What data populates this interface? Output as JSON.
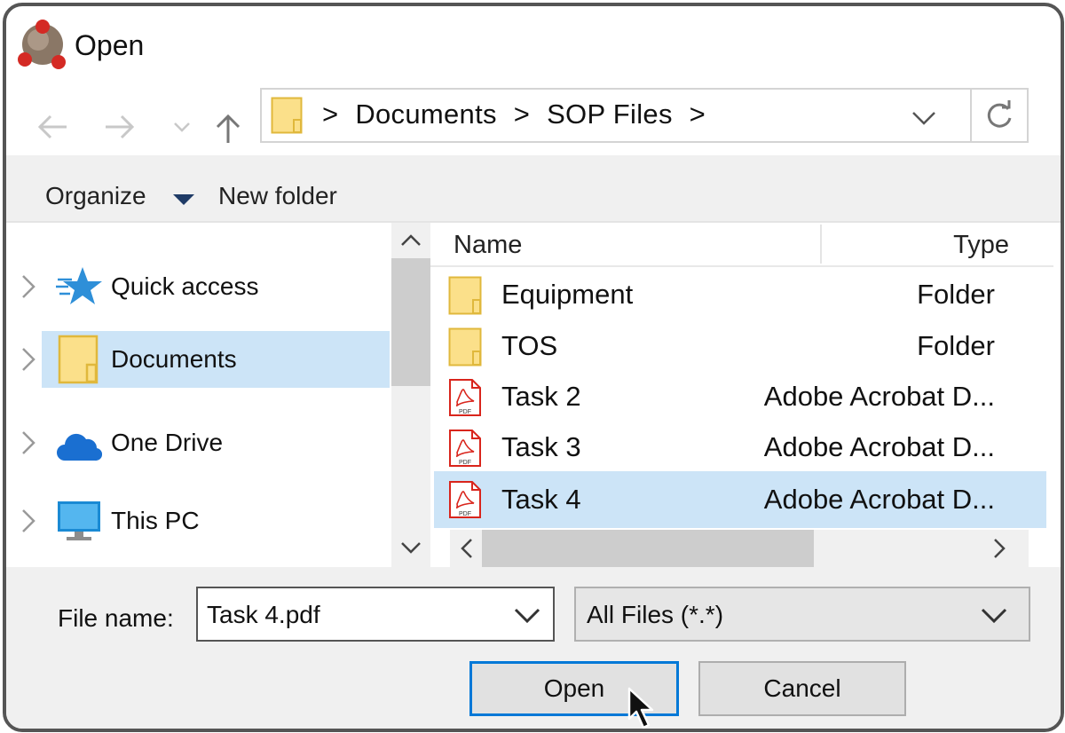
{
  "window": {
    "title": "Open"
  },
  "address": {
    "breadcrumbs": [
      ">",
      "Documents",
      ">",
      "SOP Files",
      ">"
    ]
  },
  "toolbar": {
    "organize_label": "Organize",
    "new_folder_label": "New folder"
  },
  "nav": {
    "items": [
      {
        "label": "Quick access",
        "icon": "star-icon",
        "selected": false
      },
      {
        "label": "Documents",
        "icon": "folder-icon",
        "selected": true
      },
      {
        "label": "One Drive",
        "icon": "cloud-icon",
        "selected": false
      },
      {
        "label": "This PC",
        "icon": "monitor-icon",
        "selected": false
      }
    ]
  },
  "files": {
    "columns": {
      "name": "Name",
      "type": "Type"
    },
    "rows": [
      {
        "name": "Equipment",
        "type": "Folder",
        "icon": "folder-icon",
        "selected": false
      },
      {
        "name": "TOS",
        "type": "Folder",
        "icon": "folder-icon",
        "selected": false
      },
      {
        "name": "Task 2",
        "type": "Adobe Acrobat D...",
        "icon": "pdf-icon",
        "selected": false
      },
      {
        "name": "Task 3",
        "type": "Adobe Acrobat D...",
        "icon": "pdf-icon",
        "selected": false
      },
      {
        "name": "Task 4",
        "type": "Adobe Acrobat D...",
        "icon": "pdf-icon",
        "selected": true
      }
    ]
  },
  "footer": {
    "file_name_label": "File name:",
    "file_name_value": "Task 4.pdf",
    "file_type_value": "All Files (*.*)",
    "open_label": "Open",
    "cancel_label": "Cancel"
  },
  "colors": {
    "selection": "#cce4f7",
    "accent": "#0078d7",
    "folder": "#fbe08a",
    "pdf_red": "#d9251c"
  }
}
